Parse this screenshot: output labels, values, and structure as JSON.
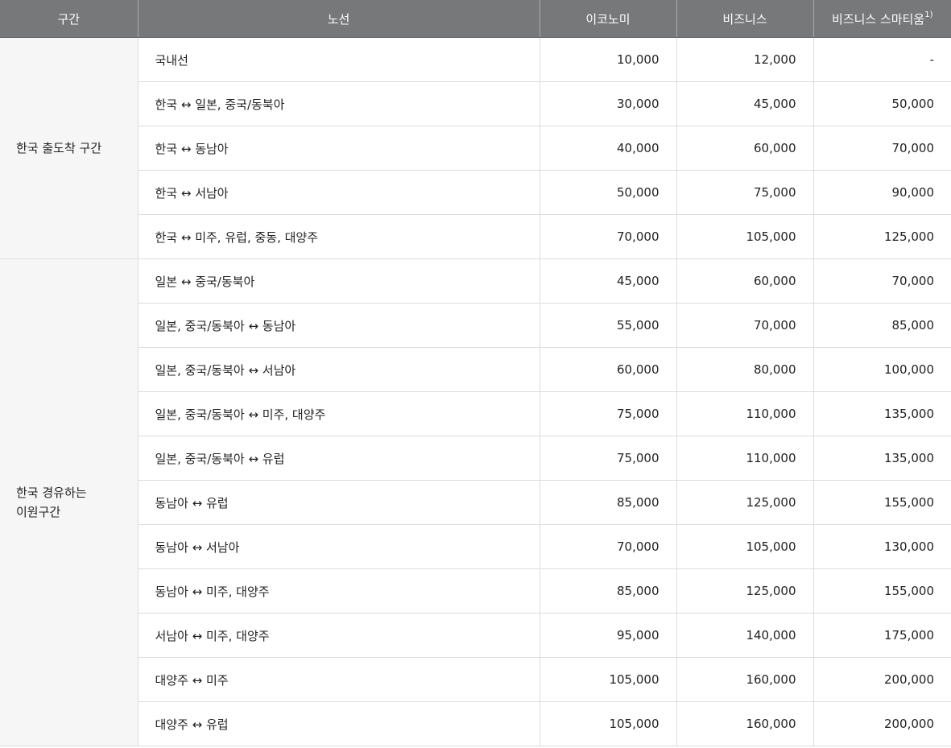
{
  "headers": {
    "section": "구간",
    "route": "노선",
    "economy": "이코노미",
    "business": "비즈니스",
    "business_smartium": "비즈니스 스마티움",
    "business_smartium_note": "1)"
  },
  "groups": [
    {
      "label_line1": "한국 출도착 구간",
      "label_line2": "",
      "rows": [
        {
          "route": "국내선",
          "economy": "10,000",
          "business": "12,000",
          "smartium": "-"
        },
        {
          "route": "한국 ↔ 일본, 중국/동북아",
          "economy": "30,000",
          "business": "45,000",
          "smartium": "50,000"
        },
        {
          "route": "한국 ↔ 동남아",
          "economy": "40,000",
          "business": "60,000",
          "smartium": "70,000"
        },
        {
          "route": "한국 ↔ 서남아",
          "economy": "50,000",
          "business": "75,000",
          "smartium": "90,000"
        },
        {
          "route": "한국 ↔ 미주, 유럽, 중동, 대양주",
          "economy": "70,000",
          "business": "105,000",
          "smartium": "125,000"
        }
      ]
    },
    {
      "label_line1": "한국 경유하는",
      "label_line2": "이원구간",
      "rows": [
        {
          "route": "일본 ↔ 중국/동북아",
          "economy": "45,000",
          "business": "60,000",
          "smartium": "70,000"
        },
        {
          "route": "일본, 중국/동북아 ↔ 동남아",
          "economy": "55,000",
          "business": "70,000",
          "smartium": "85,000"
        },
        {
          "route": "일본, 중국/동북아 ↔ 서남아",
          "economy": "60,000",
          "business": "80,000",
          "smartium": "100,000"
        },
        {
          "route": "일본, 중국/동북아 ↔ 미주, 대양주",
          "economy": "75,000",
          "business": "110,000",
          "smartium": "135,000"
        },
        {
          "route": "일본, 중국/동북아 ↔ 유럽",
          "economy": "75,000",
          "business": "110,000",
          "smartium": "135,000"
        },
        {
          "route": "동남아 ↔ 유럽",
          "economy": "85,000",
          "business": "125,000",
          "smartium": "155,000"
        },
        {
          "route": "동남아 ↔ 서남아",
          "economy": "70,000",
          "business": "105,000",
          "smartium": "130,000"
        },
        {
          "route": "동남아 ↔ 미주, 대양주",
          "economy": "85,000",
          "business": "125,000",
          "smartium": "155,000"
        },
        {
          "route": "서남아 ↔ 미주, 대양주",
          "economy": "95,000",
          "business": "140,000",
          "smartium": "175,000"
        },
        {
          "route": "대양주 ↔ 미주",
          "economy": "105,000",
          "business": "160,000",
          "smartium": "200,000"
        },
        {
          "route": "대양주 ↔ 유럽",
          "economy": "105,000",
          "business": "160,000",
          "smartium": "200,000"
        }
      ]
    }
  ]
}
